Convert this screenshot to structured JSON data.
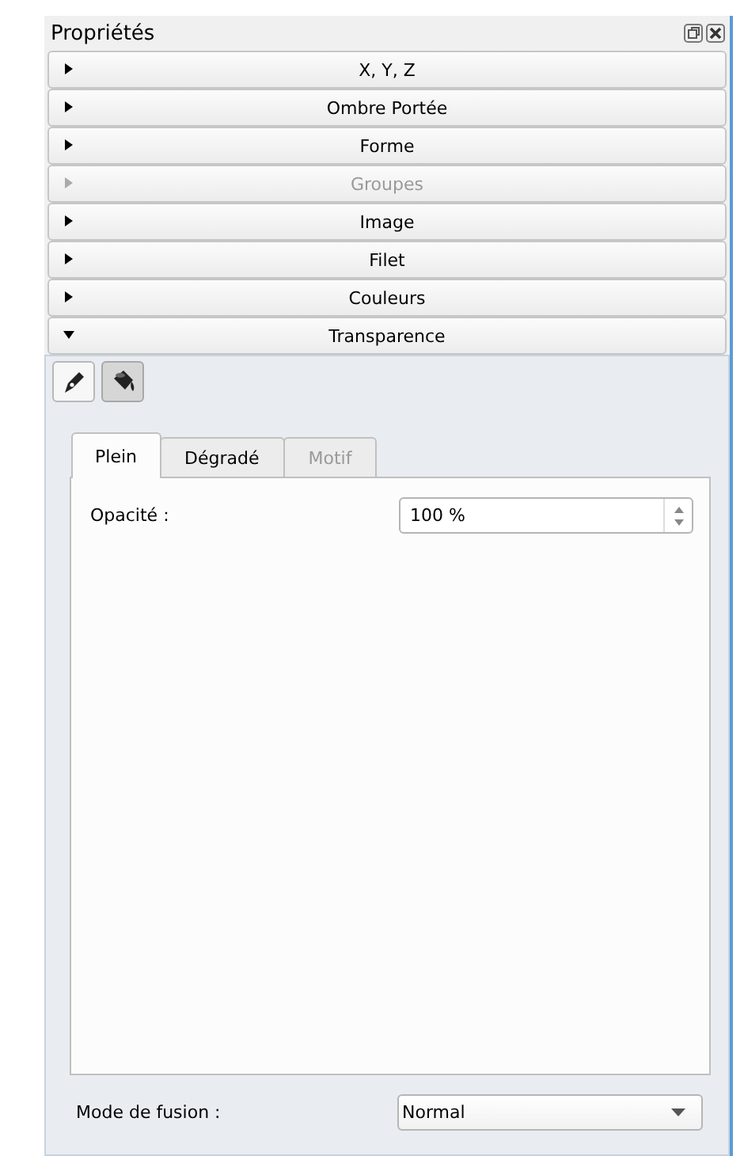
{
  "panel": {
    "title": "Propriétés"
  },
  "sections": [
    {
      "label": "X, Y, Z",
      "expanded": false,
      "disabled": false
    },
    {
      "label": "Ombre Portée",
      "expanded": false,
      "disabled": false
    },
    {
      "label": "Forme",
      "expanded": false,
      "disabled": false
    },
    {
      "label": "Groupes",
      "expanded": false,
      "disabled": true
    },
    {
      "label": "Image",
      "expanded": false,
      "disabled": false
    },
    {
      "label": "Filet",
      "expanded": false,
      "disabled": false
    },
    {
      "label": "Couleurs",
      "expanded": false,
      "disabled": false
    },
    {
      "label": "Transparence",
      "expanded": true,
      "disabled": false
    }
  ],
  "tools": [
    {
      "kind": "pen",
      "selected": false
    },
    {
      "kind": "bucket",
      "selected": true
    }
  ],
  "tabs": [
    {
      "label": "Plein",
      "selected": true,
      "disabled": false
    },
    {
      "label": "Dégradé",
      "selected": false,
      "disabled": false
    },
    {
      "label": "Motif",
      "selected": false,
      "disabled": true
    }
  ],
  "opacity": {
    "label": "Opacité :",
    "value": "100 %"
  },
  "blend": {
    "label": "Mode de fusion :",
    "value": "Normal"
  }
}
